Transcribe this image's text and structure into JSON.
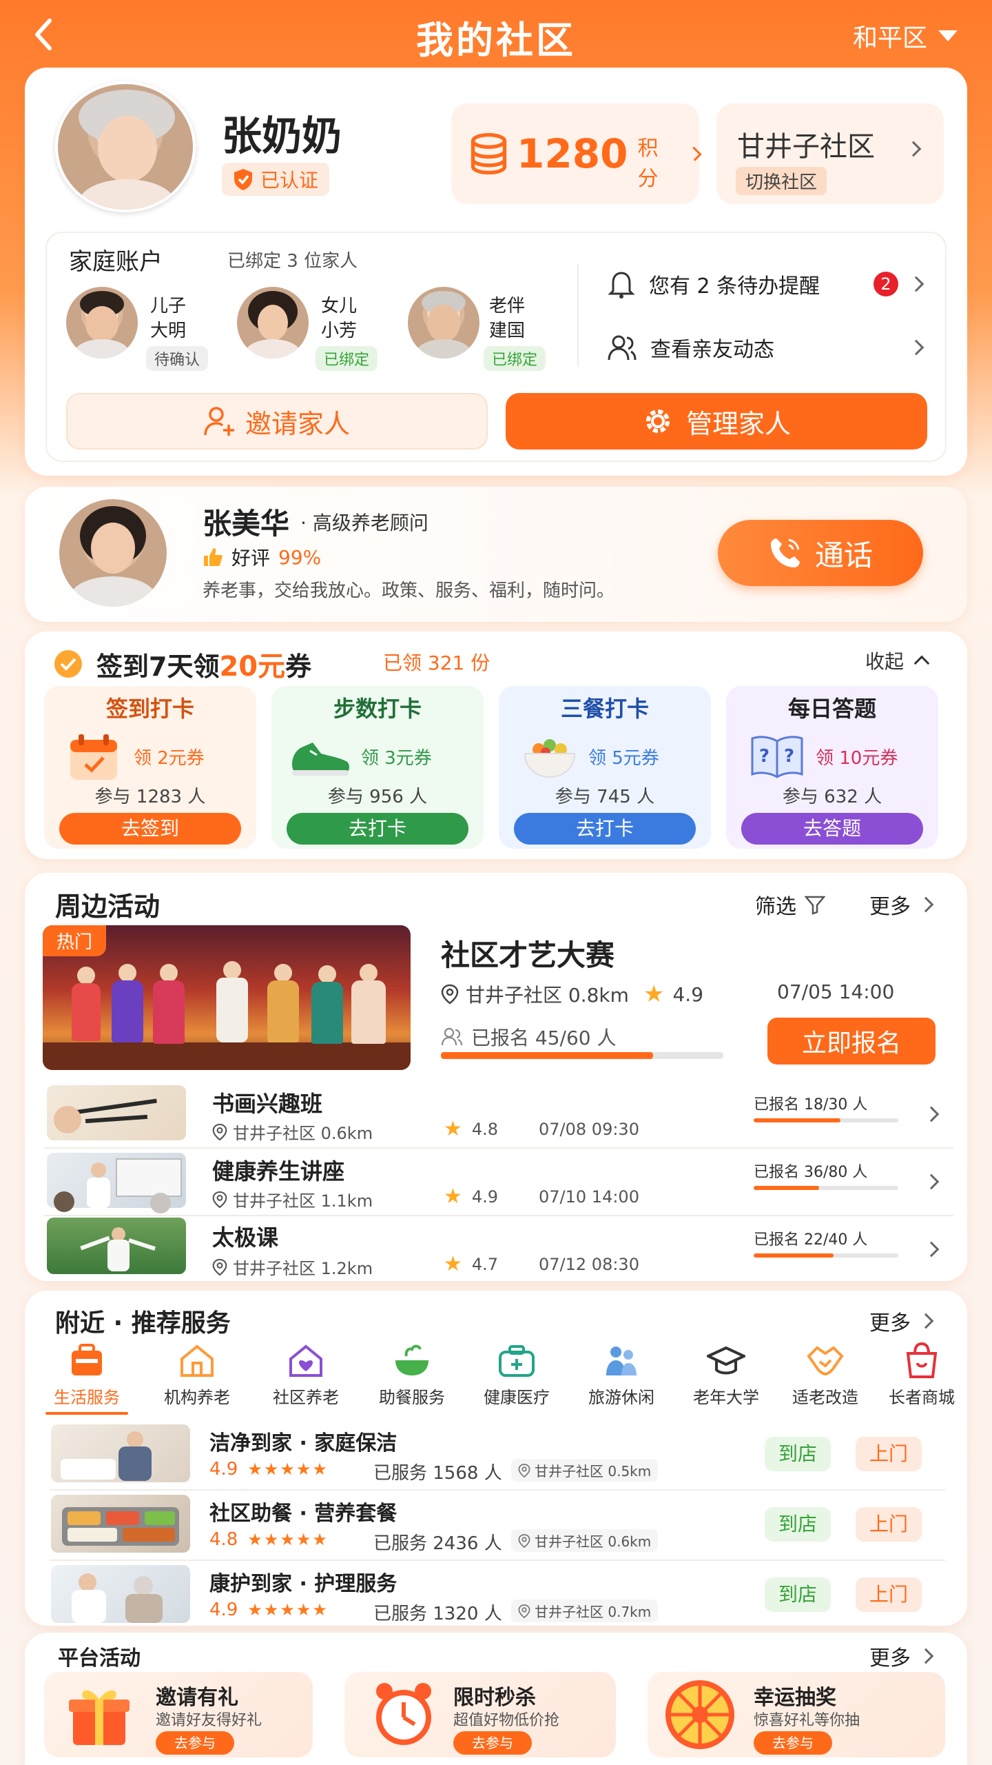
{
  "header": {
    "title": "我的社区",
    "district": "和平区"
  },
  "profile": {
    "name": "张奶奶",
    "verified": "已认证",
    "points_value": "1280",
    "points_unit": "积分",
    "community": "甘井子社区",
    "switch_label": "切换社区"
  },
  "family": {
    "title": "家庭账户",
    "bound_count": "已绑定 3 位家人",
    "members": [
      {
        "relation": "儿子",
        "name": "大明",
        "status": "待确认"
      },
      {
        "relation": "女儿",
        "name": "小芳",
        "status": "已绑定"
      },
      {
        "relation": "老伴",
        "name": "建国",
        "status": "已绑定"
      }
    ],
    "reminder_text": "您有 2 条待办提醒",
    "reminder_badge": "2",
    "feed_text": "查看亲友动态",
    "invite_label": "邀请家人",
    "manage_label": "管理家人"
  },
  "advisor": {
    "name": "张美华",
    "title": "· 高级养老顾问",
    "rating_label": "好评",
    "rating_value": "99%",
    "motto": "养老事，交给我放心。政策、服务、福利，随时问。",
    "call_label": "通话"
  },
  "checkin": {
    "title_prefix": "签到7天领",
    "title_amount": "20元",
    "title_suffix": "券",
    "claimed": "已领 321 份",
    "collapse": "收起",
    "tasks": [
      {
        "title": "签到打卡",
        "coupon": "领 2元券",
        "participants": "参与 1283 人",
        "button": "去签到",
        "color": "#ff6a1a"
      },
      {
        "title": "步数打卡",
        "coupon": "领 3元券",
        "participants": "参与 956 人",
        "button": "去打卡",
        "color": "#2f9a49"
      },
      {
        "title": "三餐打卡",
        "coupon": "领 5元券",
        "participants": "参与 745 人",
        "button": "去打卡",
        "color": "#3b7be0"
      },
      {
        "title": "每日答题",
        "coupon": "领 10元券",
        "participants": "参与 632 人",
        "button": "去答题",
        "color": "#8a4fd4"
      }
    ]
  },
  "activities": {
    "title": "周边活动",
    "filter": "筛选",
    "more": "更多",
    "featured": {
      "badge": "热门",
      "name": "社区才艺大赛",
      "location": "甘井子社区 0.8km",
      "rating": "4.9",
      "time": "07/05 14:00",
      "enrolled": "已报名 45/60 人",
      "progress": 0.75,
      "cta": "立即报名"
    },
    "items": [
      {
        "name": "书画兴趣班",
        "location": "甘井子社区 0.6km",
        "rating": "4.8",
        "time": "07/08 09:30",
        "enrolled": "已报名 18/30 人",
        "progress": 0.6
      },
      {
        "name": "健康养生讲座",
        "location": "甘井子社区 1.1km",
        "rating": "4.9",
        "time": "07/10 14:00",
        "enrolled": "已报名 36/80 人",
        "progress": 0.45
      },
      {
        "name": "太极课",
        "location": "甘井子社区 1.2km",
        "rating": "4.7",
        "time": "07/12 08:30",
        "enrolled": "已报名 22/40 人",
        "progress": 0.55
      }
    ]
  },
  "services": {
    "title": "附近 · 推荐服务",
    "more": "更多",
    "categories": [
      "生活服务",
      "机构养老",
      "社区养老",
      "助餐服务",
      "健康医疗",
      "旅游休闲",
      "老年大学",
      "适老改造",
      "长者商城"
    ],
    "active_category": "生活服务",
    "items": [
      {
        "name": "洁净到家 · 家庭保洁",
        "rating": "4.9",
        "stars": "★★★★★",
        "served": "已服务 1568 人",
        "location": "甘井子社区 0.5km",
        "store": "到店",
        "home": "上门"
      },
      {
        "name": "社区助餐 · 营养套餐",
        "rating": "4.8",
        "stars": "★★★★★",
        "served": "已服务 2436 人",
        "location": "甘井子社区 0.6km",
        "store": "到店",
        "home": "上门"
      },
      {
        "name": "康护到家 · 护理服务",
        "rating": "4.9",
        "stars": "★★★★★",
        "served": "已服务 1320 人",
        "location": "甘井子社区 0.7km",
        "store": "到店",
        "home": "上门"
      }
    ]
  },
  "platform": {
    "title": "平台活动",
    "more": "更多",
    "items": [
      {
        "title": "邀请有礼",
        "desc": "邀请好友得好礼",
        "button": "去参与"
      },
      {
        "title": "限时秒杀",
        "desc": "超值好物低价抢",
        "button": "去参与"
      },
      {
        "title": "幸运抽奖",
        "desc": "惊喜好礼等你抽",
        "button": "去参与"
      }
    ]
  },
  "colors": {
    "primary": "#ff6a1a",
    "bg": "#fff3ea",
    "badge_red": "#e8202a"
  }
}
